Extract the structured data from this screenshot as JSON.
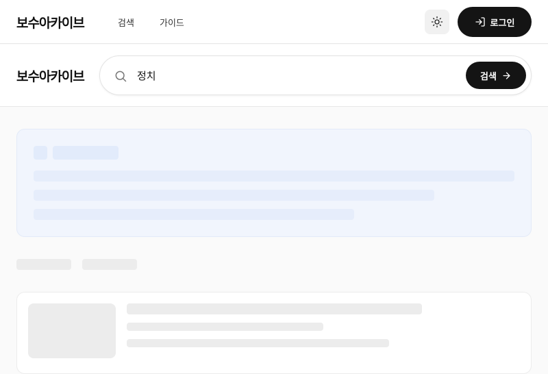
{
  "header": {
    "brand": "보수아카이브",
    "nav": {
      "search": "검색",
      "guide": "가이드"
    },
    "theme_toggle_icon": "sun-icon",
    "login_label": "로그인",
    "login_icon": "log-in-icon"
  },
  "search": {
    "brand": "보수아카이브",
    "query": "정치",
    "submit_label": "검색",
    "submit_icon": "arrow-right-icon"
  },
  "colors": {
    "accent": "#141414",
    "skeleton_blue": "#e2ebfb",
    "skeleton_gray": "#ececec"
  }
}
